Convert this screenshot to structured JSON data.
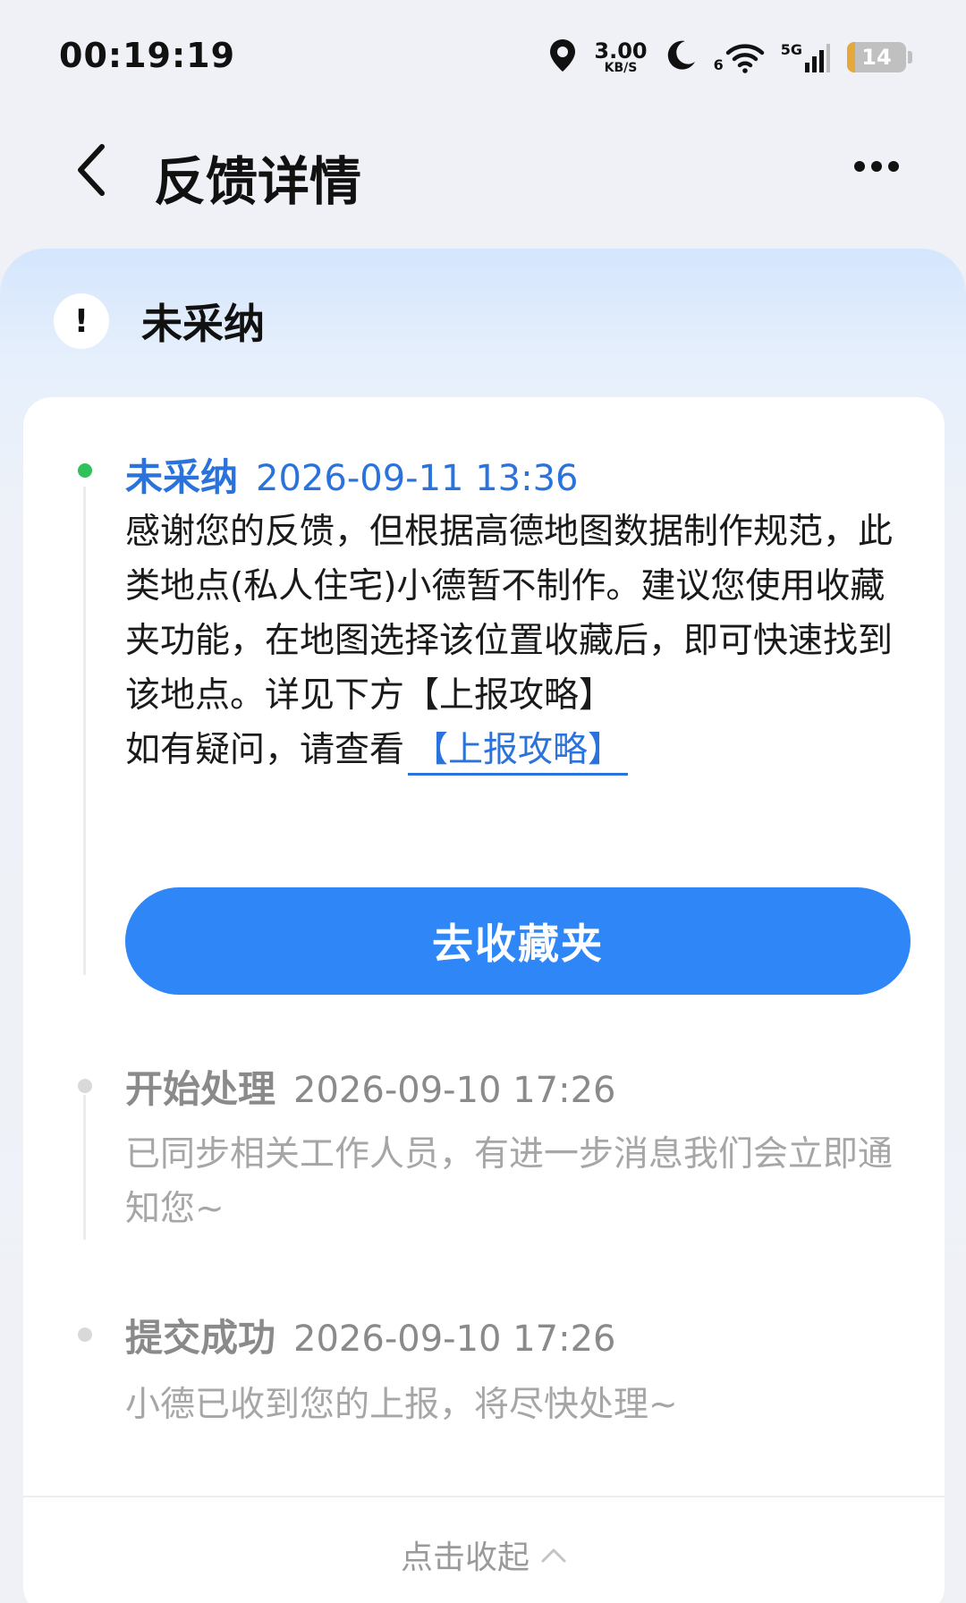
{
  "status_bar": {
    "time": "00:19:19",
    "net_speed_value": "3.00",
    "net_speed_unit": "KB/S",
    "wifi_label": "6",
    "cell_label": "5G",
    "battery_level": "14",
    "battery_fraction": 0.14,
    "icons": [
      "location-icon",
      "moon-icon",
      "wifi-icon",
      "signal-icon",
      "battery-icon"
    ]
  },
  "header": {
    "title": "反馈详情"
  },
  "status": {
    "title": "未采纳",
    "icon_glyph": "!"
  },
  "timeline": [
    {
      "label": "未采纳",
      "time": "2026-09-11 13:36",
      "body": "感谢您的反馈，但根据高德地图数据制作规范，此类地点(私人住宅)小德暂不制作。建议您使用收藏夹功能，在地图选择该位置收藏后，即可快速找到该地点。详见下方【上报攻略】",
      "question_prefix": "如有疑问，请查看",
      "question_link": "【上报攻略】",
      "action_label": "去收藏夹"
    },
    {
      "label": "开始处理",
      "time": "2026-09-10 17:26",
      "body": "已同步相关工作人员，有进一步消息我们会立即通知您~"
    },
    {
      "label": "提交成功",
      "time": "2026-09-10 17:26",
      "body": "小德已收到您的上报，将尽快处理~"
    }
  ],
  "collapse_label": "点击收起",
  "colors": {
    "accent_blue": "#2b73dc",
    "button_blue": "#2f86f6",
    "active_dot": "#2fc25b",
    "muted_text": "#a6a6a6"
  }
}
